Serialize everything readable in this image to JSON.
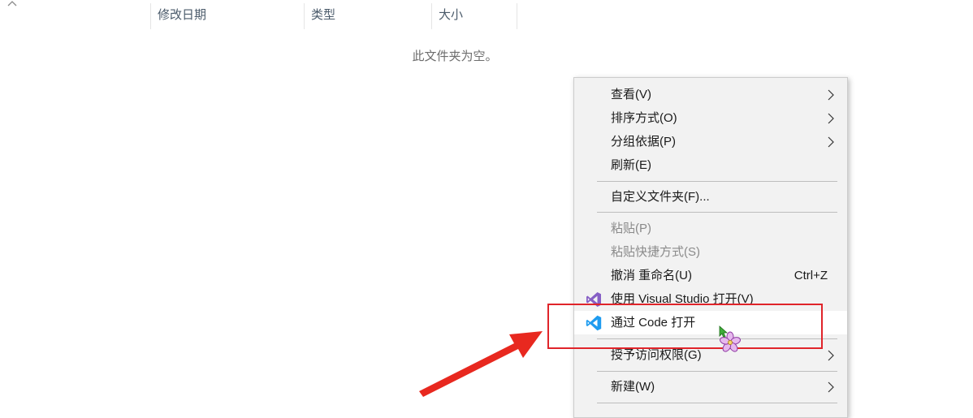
{
  "explorer": {
    "columns": [
      "修改日期",
      "类型",
      "大小"
    ],
    "empty_message": "此文件夹为空。"
  },
  "context_menu": {
    "items": [
      {
        "label": "查看(V)",
        "has_submenu": true
      },
      {
        "label": "排序方式(O)",
        "has_submenu": true
      },
      {
        "label": "分组依据(P)",
        "has_submenu": true
      },
      {
        "label": "刷新(E)"
      },
      {
        "label": "自定义文件夹(F)..."
      },
      {
        "label": "粘贴(P)",
        "disabled": true
      },
      {
        "label": "粘贴快捷方式(S)",
        "disabled": true
      },
      {
        "label": "撤消 重命名(U)",
        "shortcut": "Ctrl+Z"
      },
      {
        "label": "使用 Visual Studio 打开(V)",
        "icon": "visual-studio-icon"
      },
      {
        "label": "通过 Code 打开",
        "icon": "vscode-icon",
        "highlighted": true
      },
      {
        "label": "授予访问权限(G)",
        "has_submenu": true
      },
      {
        "label": "新建(W)",
        "has_submenu": true
      }
    ]
  },
  "colors": {
    "menu_bg": "#f2f2f2",
    "highlight_box": "#e0242a",
    "vs_purple": "#865fc5",
    "vscode_blue": "#1f9cf0"
  }
}
